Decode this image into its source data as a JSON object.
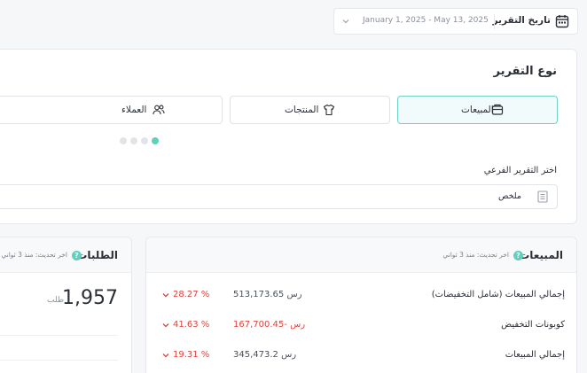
{
  "date_filter": {
    "label": "تاريخ التقرير",
    "range": "January 1, 2025 - May 13, 2025",
    "icon": "calendar-icon"
  },
  "report_type": {
    "title": "نوع التقرير",
    "options": [
      {
        "label": "المبيعات",
        "icon": "sales-box-icon",
        "selected": true
      },
      {
        "label": "المنتجات",
        "icon": "tshirt-icon",
        "selected": false
      },
      {
        "label": "العملاء",
        "icon": "users-icon",
        "selected": false
      }
    ],
    "pager": {
      "pages": 4,
      "active": 4
    },
    "sub_report": {
      "label": "اختر التقرير الفرعي",
      "value": "ملخص"
    }
  },
  "sales_card": {
    "title": "المبيعات",
    "updated": "اخر تحديث: منذ 3 ثواني",
    "rows": [
      {
        "name": "إجمالي المبيعات (شامل التخفيضات)",
        "value": "513,173.65",
        "currency": "رس",
        "change": "28.27 %",
        "negative": false
      },
      {
        "name": "كوبونات التخفيض",
        "value": "-167,700.45",
        "currency": "رس",
        "change": "41.63 %",
        "negative": true
      },
      {
        "name": "إجمالي المبيعات",
        "value": "345,473.2",
        "currency": "رس",
        "change": "19.31 %",
        "negative": false
      }
    ]
  },
  "orders_card": {
    "title": "الطلبات",
    "updated": "اخر تحديث: منذ 3 ثواني",
    "value": "1,957",
    "unit": "طلب"
  },
  "colors": {
    "accent": "#5fd0bc",
    "danger": "#e0433b",
    "border": "#e6e8eb"
  }
}
